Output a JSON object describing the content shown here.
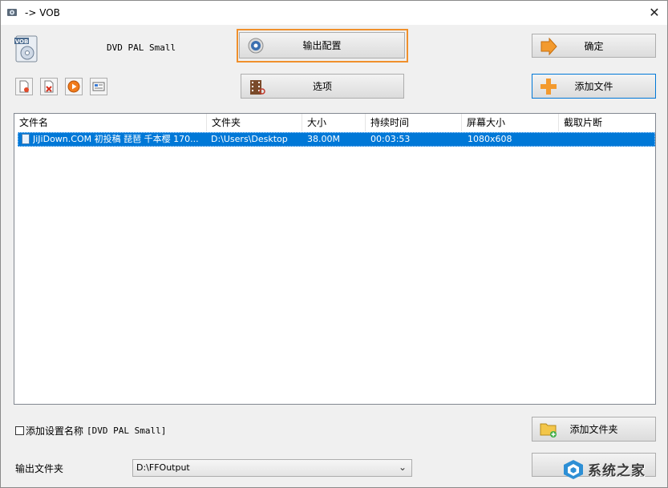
{
  "window": {
    "title": "-> VOB",
    "close_glyph": "✕"
  },
  "preset": {
    "name": "DVD PAL Small",
    "icon_text": "VOB"
  },
  "buttons": {
    "output_config": "输出配置",
    "ok": "确定",
    "options": "选项",
    "add_file": "添加文件",
    "add_folder": "添加文件夹"
  },
  "toolbar": {
    "items": [
      "remove-file-icon",
      "clear-list-icon",
      "play-icon",
      "media-info-icon"
    ]
  },
  "file_list": {
    "columns": [
      "文件名",
      "文件夹",
      "大小",
      "持续时间",
      "屏幕大小",
      "截取片断"
    ],
    "rows": [
      {
        "name": "JiJiDown.COM 初投稿 琵琶 千本樱 170...",
        "folder": "D:\\Users\\Desktop",
        "size": "38.00M",
        "duration": "00:03:53",
        "screen": "1080x608",
        "clip": ""
      }
    ]
  },
  "options": {
    "add_preset_name_label": "添加设置名称",
    "preset_tag": "[DVD PAL Small]",
    "checked": false
  },
  "output": {
    "label": "输出文件夹",
    "folder": "D:\\FFOutput"
  },
  "watermark": {
    "text": "系统之家"
  },
  "colors": {
    "selection": "#0078d7",
    "highlight_frame": "#f0902c"
  }
}
